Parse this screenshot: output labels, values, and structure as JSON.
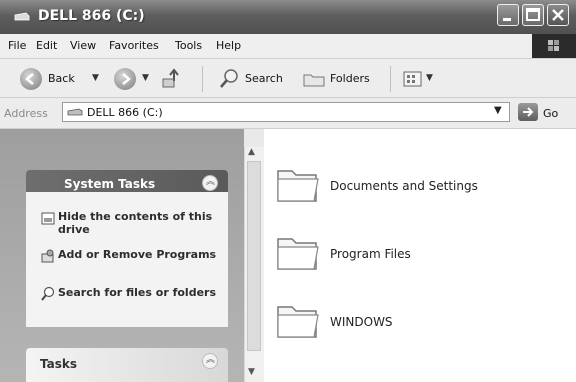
{
  "window": {
    "title": "DELL 866 (C:)"
  },
  "menubar": {
    "items": [
      "File",
      "Edit",
      "View",
      "Favorites",
      "Tools",
      "Help"
    ]
  },
  "toolbar": {
    "back_label": "Back",
    "search_label": "Search",
    "folders_label": "Folders"
  },
  "address": {
    "label": "Address",
    "value": "DELL 866 (C:)",
    "go_label": "Go"
  },
  "system_tasks": {
    "title": "System Tasks",
    "items": [
      {
        "label": "Hide the contents of this drive",
        "icon": "hide-contents-icon"
      },
      {
        "label": "Add or Remove Programs",
        "icon": "add-remove-programs-icon"
      },
      {
        "label": "Search for files or folders",
        "icon": "search-icon"
      }
    ]
  },
  "tasks_panel": {
    "title": "Tasks"
  },
  "folders": [
    {
      "name": "Documents and Settings"
    },
    {
      "name": "Program Files"
    },
    {
      "name": "WINDOWS"
    }
  ]
}
